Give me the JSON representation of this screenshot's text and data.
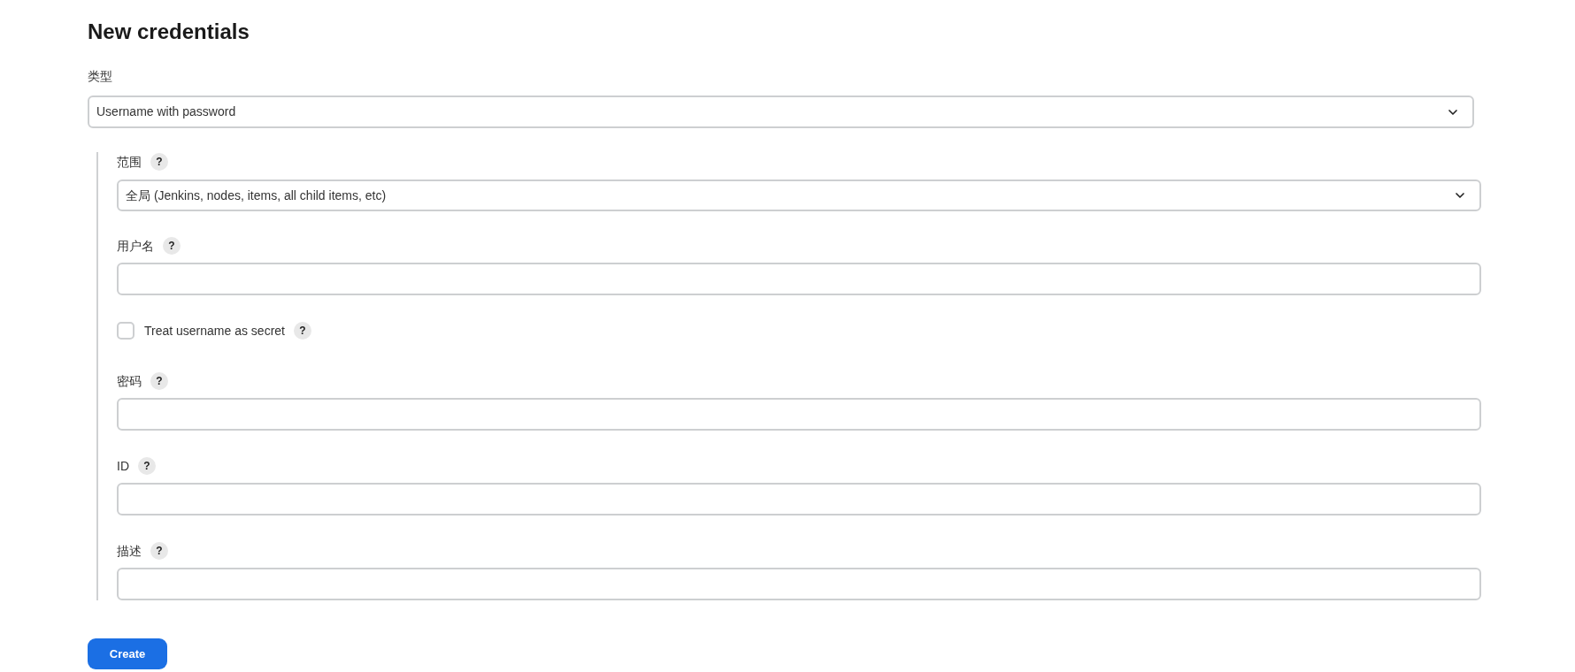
{
  "title": "New credentials",
  "type_field": {
    "label": "类型",
    "value": "Username with password"
  },
  "fields": [
    {
      "kind": "select",
      "label": "范围",
      "help": "?",
      "value": "全局 (Jenkins, nodes, items, all child items, etc)"
    },
    {
      "kind": "text",
      "label": "用户名",
      "help": "?"
    },
    {
      "kind": "checkbox",
      "label": "Treat username as secret",
      "help": "?",
      "checked": false
    },
    {
      "kind": "text",
      "label": "密码",
      "help": "?"
    },
    {
      "kind": "text",
      "label": "ID",
      "help": "?"
    },
    {
      "kind": "text",
      "label": "描述",
      "help": "?"
    }
  ],
  "submit_button": {
    "label": "Create"
  }
}
